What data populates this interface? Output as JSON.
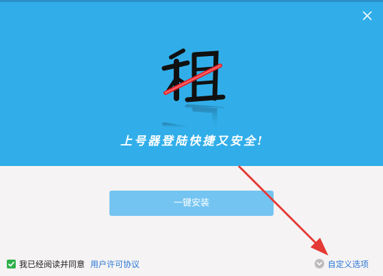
{
  "window": {
    "close_icon": "close-icon"
  },
  "header": {
    "logo_text": "租",
    "slogan": "上号器登陆快捷又安全!",
    "background_color": "#31aee9"
  },
  "main": {
    "install_button_label": "一键安装",
    "install_button_color": "#74c4f2"
  },
  "footer": {
    "agree_checked": true,
    "agree_label": "我已经阅读并同意",
    "agreement_link": "用户许可协议",
    "custom_options_label": "自定义选项",
    "custom_options_icon": "chevron-down-circle-icon"
  },
  "annotation": {
    "arrow_color": "#e53935"
  }
}
